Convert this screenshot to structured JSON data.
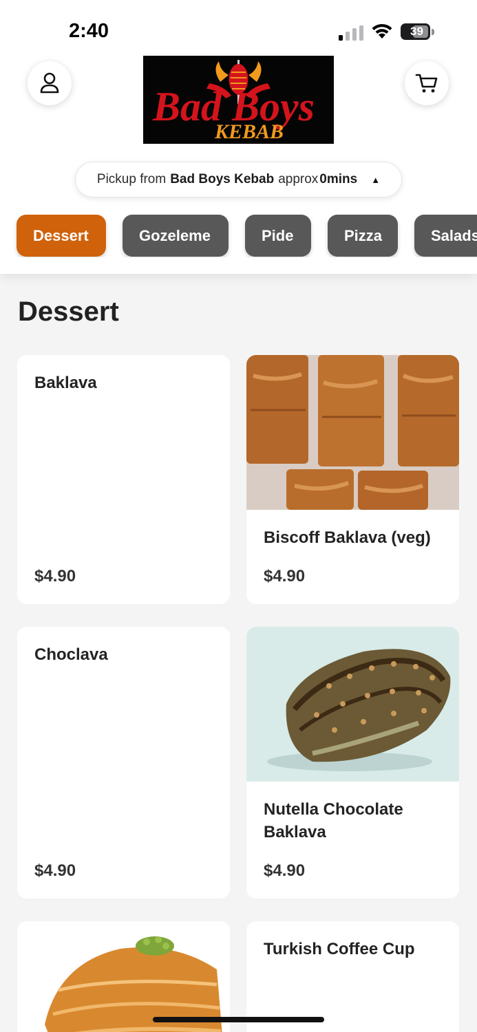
{
  "status_bar": {
    "time": "2:40",
    "battery": "39"
  },
  "header": {
    "account_icon": "person-icon",
    "cart_icon": "cart-icon",
    "logo_text_top": "Bad Boys",
    "logo_text_bottom": "KEBAB"
  },
  "pickup": {
    "prefix": "Pickup from",
    "store": "Bad Boys Kebab",
    "middle": "approx",
    "time": "0mins"
  },
  "categories": [
    {
      "label": "Dessert",
      "active": true
    },
    {
      "label": "Gozeleme",
      "active": false
    },
    {
      "label": "Pide",
      "active": false
    },
    {
      "label": "Pizza",
      "active": false
    },
    {
      "label": "Salads",
      "active": false
    }
  ],
  "section": {
    "title": "Dessert"
  },
  "items": [
    {
      "name": "Baklava",
      "price": "$4.90",
      "has_photo": false
    },
    {
      "name": "Biscoff Baklava (veg)",
      "price": "$4.90",
      "has_photo": true
    },
    {
      "name": "Choclava",
      "price": "$4.90",
      "has_photo": false
    },
    {
      "name": "Nutella Chocolate Baklava",
      "price": "$4.90",
      "has_photo": true
    },
    {
      "name": "",
      "price": "",
      "has_photo": true
    },
    {
      "name": "Turkish Coffee Cup",
      "price": "",
      "has_photo": false
    }
  ],
  "colors": {
    "accent": "#d0620b",
    "chip_inactive": "#585858",
    "background": "#f4f4f5",
    "logo_red": "#d4141c",
    "logo_orange": "#f19a1e"
  }
}
